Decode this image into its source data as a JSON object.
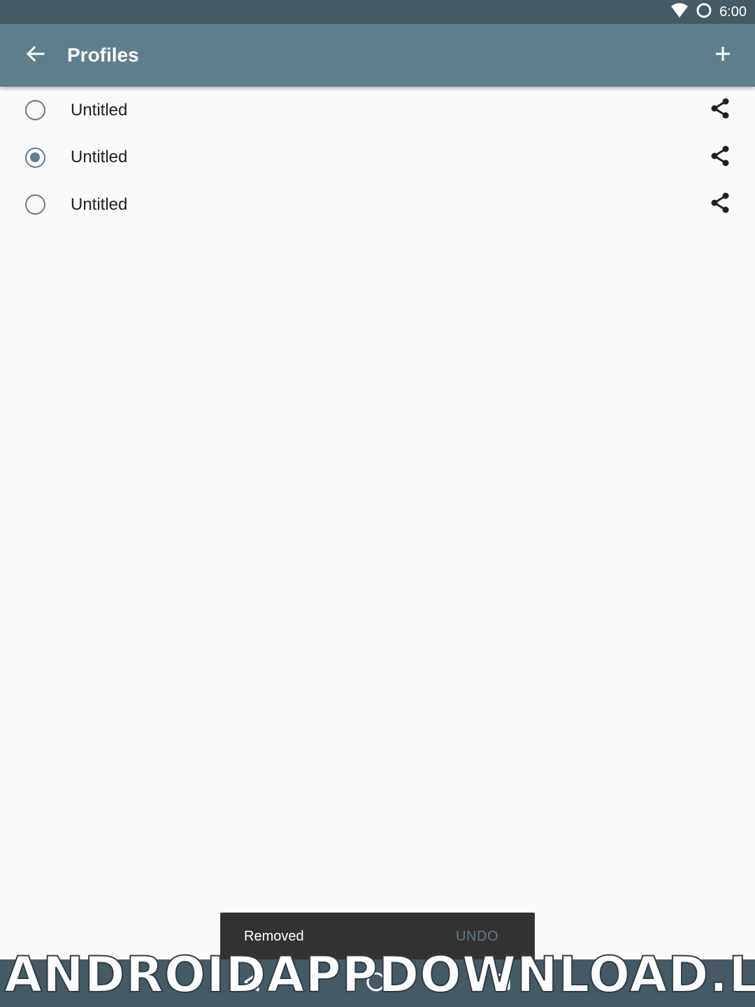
{
  "status_bar": {
    "time": "6:00",
    "icons": [
      "wifi-icon",
      "sync-circle-icon"
    ]
  },
  "app_bar": {
    "title": "Profiles",
    "back_icon": "arrow-back-icon",
    "add_icon": "plus-icon"
  },
  "profiles": [
    {
      "name": "Untitled",
      "selected": false
    },
    {
      "name": "Untitled",
      "selected": true
    },
    {
      "name": "Untitled",
      "selected": false
    }
  ],
  "snackbar": {
    "message": "Removed",
    "action": "UNDO"
  },
  "nav_bar": {
    "icons": [
      "back-triangle-icon",
      "home-circle-icon",
      "recents-square-icon"
    ]
  },
  "watermark": {
    "text": "ANDROIDAPPDOWNLOAD.L"
  },
  "colors": {
    "status_bar": "#455a64",
    "app_bar": "#607d8b",
    "accent": "#607d8b",
    "background": "#fafafa",
    "snackbar": "#323232"
  }
}
